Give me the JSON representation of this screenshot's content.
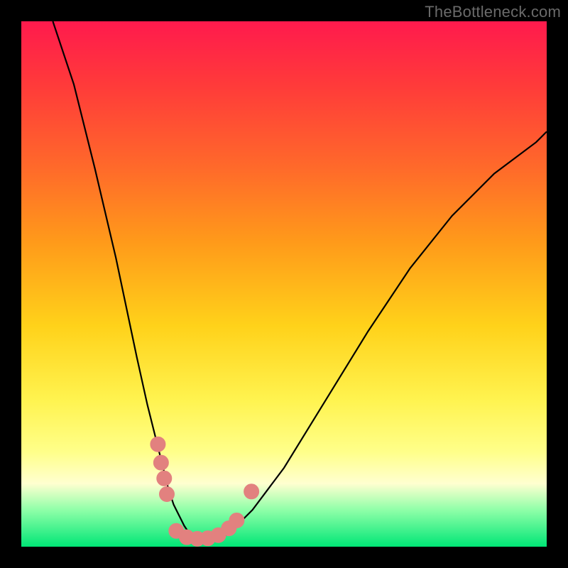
{
  "watermark": "TheBottleneck.com",
  "colors": {
    "page_bg": "#000000",
    "curve_stroke": "#000000",
    "marker_fill": "#e2817f",
    "marker_stroke": "#e2817f"
  },
  "chart_data": {
    "type": "line",
    "title": "",
    "xlabel": "",
    "ylabel": "",
    "xlim": [
      0,
      100
    ],
    "ylim": [
      0,
      100
    ],
    "grid": false,
    "legend": false,
    "series": [
      {
        "name": "bottleneck-curve",
        "x": [
          6,
          10,
          14,
          18,
          22,
          24,
          26,
          28,
          29,
          30,
          31,
          32,
          33,
          34,
          36,
          38,
          40,
          44,
          50,
          58,
          66,
          74,
          82,
          90,
          98,
          100
        ],
        "y": [
          100,
          88,
          72,
          55,
          36,
          27,
          19,
          11,
          8,
          6,
          4,
          2.5,
          1.5,
          1,
          1,
          1.5,
          3,
          7,
          15,
          28,
          41,
          53,
          63,
          71,
          77,
          79
        ]
      }
    ],
    "markers": [
      {
        "x": 26.0,
        "y": 19.5
      },
      {
        "x": 26.6,
        "y": 16.0
      },
      {
        "x": 27.2,
        "y": 13.0
      },
      {
        "x": 27.7,
        "y": 10.0
      },
      {
        "x": 29.5,
        "y": 3.0
      },
      {
        "x": 31.5,
        "y": 1.8
      },
      {
        "x": 33.5,
        "y": 1.5
      },
      {
        "x": 35.5,
        "y": 1.6
      },
      {
        "x": 37.5,
        "y": 2.2
      },
      {
        "x": 39.5,
        "y": 3.5
      },
      {
        "x": 41.0,
        "y": 5.0
      },
      {
        "x": 43.8,
        "y": 10.5
      }
    ],
    "marker_radius_px": 10.5
  }
}
